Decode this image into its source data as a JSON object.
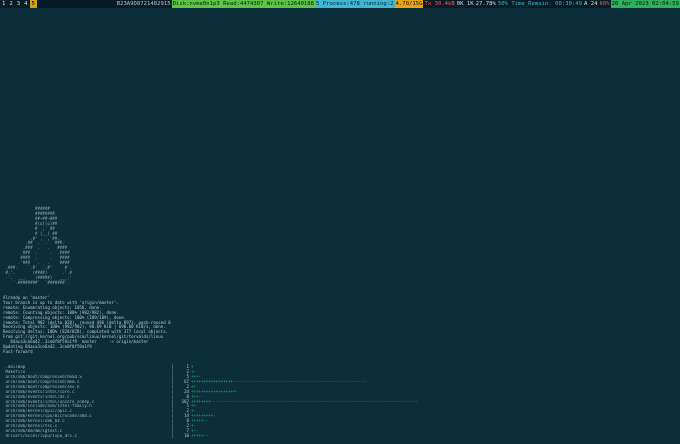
{
  "statusbar": {
    "workspaces": [
      "1",
      "2",
      "3",
      "4",
      "5"
    ],
    "active_workspace": "5",
    "left_id": "B23A9D87",
    "segments": [
      {
        "text": "B23A9D8721482915",
        "bg": "#071c24",
        "fg": "#a9c7d0"
      },
      {
        "text": "Disk:nvme0n1p3 Read:4474307 Write:12640188",
        "bg": "#5ec447",
        "fg": "#06210c"
      },
      {
        "text": "5 Process:478 running:2",
        "bg": "#3fb7d4",
        "fg": "#06202a"
      },
      {
        "text": "4.70/15G",
        "bg": "#e8a417",
        "fg": "#1b1200"
      },
      {
        "text": "Tx 30.4kB",
        "bg": "#071c24",
        "fg": "#e05d5d"
      },
      {
        "text": "0K 1K",
        "bg": "#071c24",
        "fg": "#cfe3ea"
      },
      {
        "text": "27.78%",
        "bg": "#071c24",
        "fg": "#cfe3ea"
      },
      {
        "text": "50% Time_Remain: 00:30:49",
        "bg": "#071c24",
        "fg": "#3fb7d4"
      },
      {
        "text": "A 24",
        "bg": "#071c24",
        "fg": "#cfe3ea"
      },
      {
        "text": "60%",
        "bg": "#071c24",
        "fg": "#e05d5d"
      },
      {
        "text": "20 Apr 2023 02:04:59",
        "bg": "#2fb05a",
        "fg": "#04160a"
      }
    ]
  },
  "terminal": {
    "ascii_art": [
      "             ######",
      "             ########.",
      "             ##~##~###",
      "             #(o)(o)##",
      "             #  ,  ##",
      "             # (__) ##",
      "           .#' ,  ,`##.",
      "         .##  .  .   ###.",
      "        .###  .   .   ####",
      "        ###  .     .  .####",
      "       ####  .     .   ####",
      "      .'###   .   .    ####",
      " .###.    `.#'  `.#'     #'.",
      " #.'.       (####)      .'.#",
      "  `.  ___    (#####)   ___.'",
      "    `.########'  `#######'."
    ],
    "git_lines": [
      "Already on 'master'",
      "Your branch is up to date with 'origin/master'.",
      "remote: Enumerating objects: 1056, done.",
      "remote: Counting objects: 100% (982/982), done.",
      "remote: Compressing objects: 100% (189/189), done.",
      "remote: Total 982 (delta 828), reused 496 (delta 897), pack-reused 0",
      "Receiving objects: 100% (982/982), 90.69 KiB | 690.00 KiB/s, done.",
      "Resolving deltas: 100% (828/828), completed with 377 local objects.",
      "From git://git.kernel.org/pub/scm/linux/kernel/git/torvalds/linux",
      "   84aca3ce6a42..3ce0f8f59a1f9  master     -> origin/master",
      "Updating 84aca3ce6a42..3ce0f8f59a1f9",
      "Fast-forward"
    ],
    "diffstat": [
      {
        "path": " .mailmap",
        "num": "1",
        "bar": "+",
        "del": ""
      },
      {
        "path": " Makefile",
        "num": "2",
        "bar": "+",
        "del": "-"
      },
      {
        "path": " arch/x86/boot/compressed/head.S",
        "num": "5",
        "bar": "+++-",
        "del": ""
      },
      {
        "path": " arch/x86/boot/compressed/mem.c",
        "num": "67",
        "bar": "+++++++++++++++++",
        "del": "------------------------------------------------------"
      },
      {
        "path": " arch/x86/boot/compressed/sev.h",
        "num": "2",
        "bar": "++",
        "del": ""
      },
      {
        "path": " arch/x86/events/intel/core.c",
        "num": "24",
        "bar": "++++++++++++++++++",
        "del": "-"
      },
      {
        "path": " arch/x86/events/intel/ds.c",
        "num": "8",
        "bar": "+++--",
        "del": ""
      },
      {
        "path": " arch/x86/events/intel/uncore_snbep.c",
        "num": "107",
        "bar": "++++++++",
        "del": "------------------------------------------------------------------------------------"
      },
      {
        "path": " arch/x86/include/asm/intel-family.h",
        "num": "5",
        "bar": "++",
        "del": ""
      },
      {
        "path": " arch/x86/kernel/apic/apic.c",
        "num": "2",
        "bar": "+-",
        "del": ""
      },
      {
        "path": " arch/x86/kernel/cpu/microcode/amd.c",
        "num": "14",
        "bar": "+++++++++",
        "del": "-"
      },
      {
        "path": " arch/x86/kernel/x86_64.c",
        "num": "8",
        "bar": "+++++--",
        "del": ""
      },
      {
        "path": " arch/x86/kernel/tsc.c",
        "num": "2",
        "bar": "+-",
        "del": ""
      },
      {
        "path": " arch/x86/mm/mm/igtext.c",
        "num": "7",
        "bar": "+--",
        "del": ""
      },
      {
        "path": " drivers/accel/ivpu/ivpu_drv.c",
        "num": "10",
        "bar": "+++++--",
        "del": ""
      }
    ]
  },
  "colors": {
    "background": "#0c2d3a",
    "bar_background": "#071c24",
    "text": "#b9ccd3",
    "insertions": "#2ec27e",
    "deletions": "#e05d5d",
    "active_workspace": "#d4a017"
  }
}
